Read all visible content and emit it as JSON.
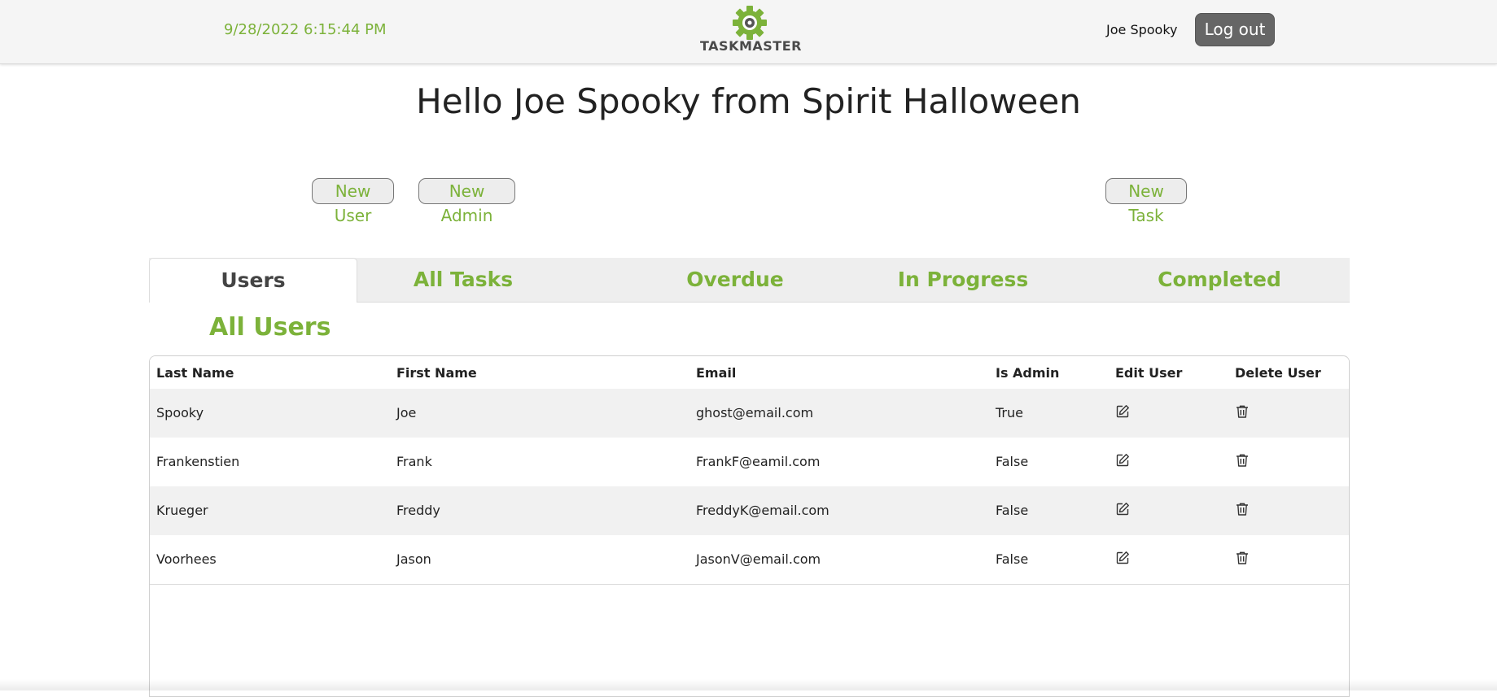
{
  "header": {
    "datetime": "9/28/2022 6:15:44 PM",
    "logo_text": "TASKMASTER",
    "username": "Joe Spooky",
    "logout_label": "Log out",
    "accent_color": "#7cb23a"
  },
  "greeting": "Hello Joe Spooky from Spirit Halloween",
  "actions": {
    "new_user": "New User",
    "new_admin": "New Admin",
    "new_task": "New Task"
  },
  "tabs": [
    {
      "label": "Users",
      "active": true
    },
    {
      "label": "All Tasks",
      "active": false
    },
    {
      "label": "Overdue",
      "active": false
    },
    {
      "label": "In Progress",
      "active": false
    },
    {
      "label": "Completed",
      "active": false
    }
  ],
  "section_title": "All Users",
  "table": {
    "columns": [
      "Last Name",
      "First Name",
      "Email",
      "Is Admin",
      "Edit User",
      "Delete User"
    ],
    "rows": [
      {
        "last": "Spooky",
        "first": "Joe",
        "email": "ghost@email.com",
        "admin": "True"
      },
      {
        "last": "Frankenstien",
        "first": "Frank",
        "email": "FrankF@eamil.com",
        "admin": "False"
      },
      {
        "last": "Krueger",
        "first": "Freddy",
        "email": "FreddyK@email.com",
        "admin": "False"
      },
      {
        "last": "Voorhees",
        "first": "Jason",
        "email": "JasonV@email.com",
        "admin": "False"
      }
    ],
    "edit_icon": "edit-icon",
    "delete_icon": "trash-icon"
  }
}
